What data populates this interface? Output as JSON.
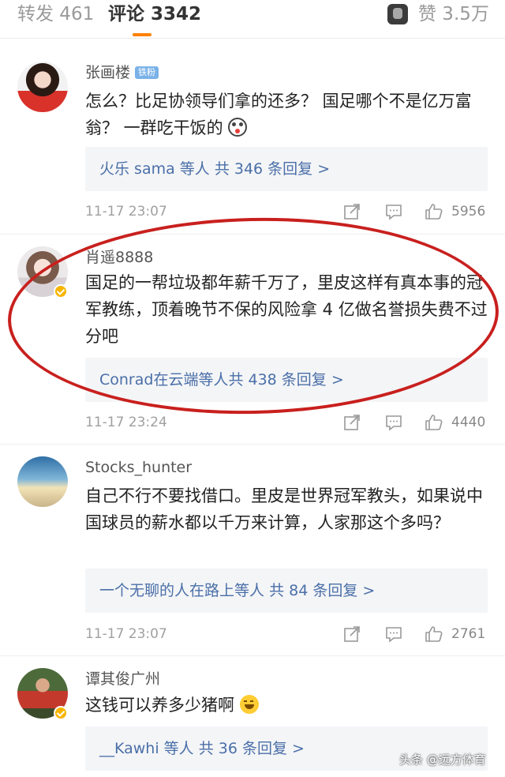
{
  "tabs": {
    "repost_label": "转发 461",
    "comment_label": "评论 3342",
    "like_label": "赞 3.5万"
  },
  "comments": [
    {
      "username": "张画楼",
      "badge": "铁粉",
      "content": "怎么？比足协领导们拿的还多？ 国足哪个不是亿万富翁？ 一群吃干饭的",
      "emoji": "scared-face-emoji",
      "replies_who": "火乐 sama 等人",
      "replies_count": "共 346 条回复 >",
      "time": "11-17 23:07",
      "likes": "5956"
    },
    {
      "username": "肖遥8888",
      "content": "国足的一帮垃圾都年薪千万了，里皮这样有真本事的冠军教练，顶着晚节不保的风险拿 4 亿做名誉损失费不过分吧",
      "replies_who": "Conrad在云端等人",
      "replies_count": "共 438 条回复 >",
      "time": "11-17 23:24",
      "likes": "4440"
    },
    {
      "username": "Stocks_hunter",
      "content": "自己不行不要找借口。里皮是世界冠军教头，如果说中国球员的薪水都以千万来计算，人家那这个多吗？",
      "replies_who": "一个无聊的人在路上等人",
      "replies_count": "共 84 条回复 >",
      "time": "11-17 23:07",
      "likes": "2761"
    },
    {
      "username": "谭其俊广州",
      "content": "这钱可以养多少猪啊",
      "emoji": "laughing-tears-emoji",
      "replies_who": "__Kawhi 等人",
      "replies_count": "共 36 条回复 >"
    }
  ],
  "watermark": "头条 @远方体育",
  "colors": {
    "accent": "#ff8200",
    "link": "#4a6fa8",
    "annotation_circle": "#c8201e",
    "verified": "#f7b500"
  }
}
